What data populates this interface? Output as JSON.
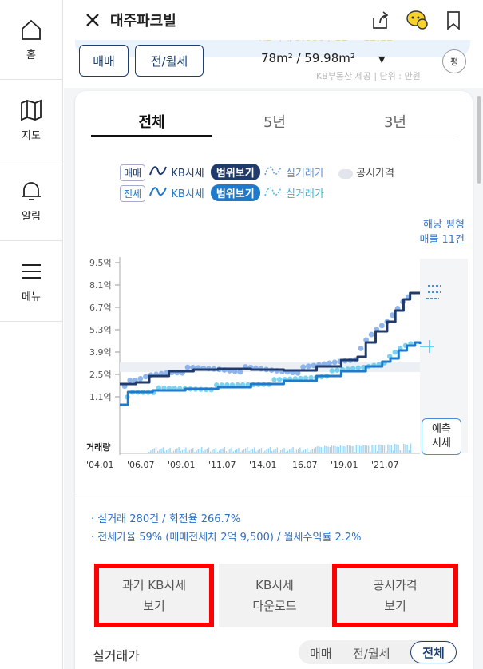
{
  "sidebar": {
    "items": [
      {
        "label": "홈",
        "icon": "home-icon"
      },
      {
        "label": "지도",
        "icon": "map-icon"
      },
      {
        "label": "알림",
        "icon": "bell-icon"
      },
      {
        "label": "메뉴",
        "icon": "menu-icon"
      }
    ]
  },
  "header": {
    "title": "대주파크빌",
    "icons": [
      "close-icon",
      "share-icon",
      "chat-icon",
      "bookmark-icon"
    ]
  },
  "filter": {
    "sale_label": "매매",
    "lease_label": "전/월세",
    "area": "78m² / 59.98m²",
    "unit_toggle": "평",
    "source_note": "KB부동산 제공 | 단위 : 만원"
  },
  "tabs": [
    "전체",
    "5년",
    "3년"
  ],
  "legend": {
    "row1": {
      "tag": "매매",
      "kb": "KB시세",
      "range": "범위보기",
      "actual": "실거래가",
      "public": "공시가격"
    },
    "row2": {
      "tag": "전세",
      "kb": "KB시세",
      "range": "범위보기",
      "actual": "실거래가"
    }
  },
  "listing_note": {
    "line1": "해당 평형",
    "line2": "매물 11건"
  },
  "volume_label": "거래량",
  "forecast": {
    "line1": "예측",
    "line2": "시세"
  },
  "colors": {
    "sale_kb": "#1f3a6b",
    "lease_kb": "#1f7acb",
    "sale_actual": "#6b9de8",
    "lease_actual": "#45c1e8",
    "highlight": "#ff0000"
  },
  "chart_data": {
    "type": "line",
    "x_ticks": [
      "'04.01",
      "'06.07",
      "'09.01",
      "'11.07",
      "'14.01",
      "'16.07",
      "'19.01",
      "'21.07"
    ],
    "y_ticks": [
      "9.5억",
      "8.1억",
      "6.7억",
      "5.3억",
      "3.9억",
      "2.5억",
      "1.1억"
    ],
    "ylim": [
      1.1,
      9.5
    ],
    "y_unit": "억",
    "series": [
      {
        "name": "매매 KB시세",
        "x": [
          2004.0,
          2005.0,
          2005.8,
          2007.0,
          2008.5,
          2010.0,
          2012.0,
          2014.0,
          2015.0,
          2016.0,
          2017.5,
          2018.5,
          2019.0,
          2019.6,
          2020.3,
          2020.8,
          2021.3,
          2021.7,
          2022.3
        ],
        "values": [
          1.9,
          2.0,
          2.4,
          2.7,
          2.8,
          2.85,
          2.8,
          2.75,
          2.75,
          3.0,
          3.4,
          3.6,
          4.5,
          5.2,
          5.8,
          6.5,
          7.2,
          7.6,
          7.6
        ]
      },
      {
        "name": "전세 KB시세",
        "x": [
          2004.0,
          2004.4,
          2004.5,
          2006.0,
          2008.0,
          2010.0,
          2012.0,
          2014.0,
          2016.0,
          2017.5,
          2019.0,
          2020.0,
          2020.5,
          2021.0,
          2021.5,
          2022.0,
          2022.3
        ],
        "values": [
          0.6,
          0.6,
          1.4,
          1.5,
          1.6,
          1.7,
          1.9,
          2.1,
          2.4,
          2.7,
          3.0,
          3.3,
          3.5,
          4.0,
          4.3,
          4.5,
          4.4
        ]
      }
    ]
  },
  "stats": {
    "line1": "· 실거래 280건 / 회전율 266.7%",
    "line2": "· 전세가율 59% (매매전세차 2억 9,500) / 월세수익률 2.2%"
  },
  "actions": [
    {
      "line1": "과거 KB시세",
      "line2": "보기"
    },
    {
      "line1": "KB시세",
      "line2": "다운로드"
    },
    {
      "line1": "공시가격",
      "line2": "보기"
    }
  ],
  "trade": {
    "title": "실거래가",
    "options": [
      "매매",
      "전/월세",
      "전체"
    ]
  }
}
